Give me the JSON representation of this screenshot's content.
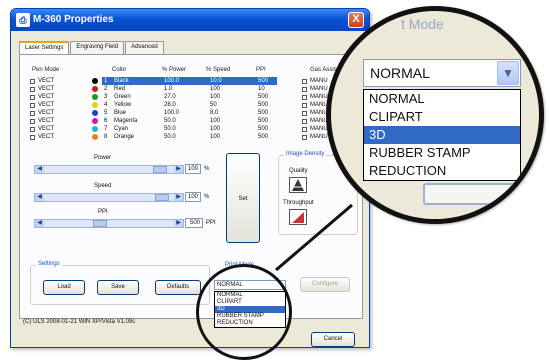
{
  "window": {
    "title": "M-360 Properties",
    "close_label": "X",
    "app_icon": "printer-icon"
  },
  "tabs": [
    {
      "label": "Laser Settings",
      "active": true
    },
    {
      "label": "Engraving Field",
      "active": false
    },
    {
      "label": "Advanced",
      "active": false
    }
  ],
  "pen_table": {
    "headers": {
      "pen_mode": "Pen Mode",
      "color": "Color",
      "power": "% Power",
      "speed": "% Speed",
      "ppi": "PPI",
      "gas_assist": "Gas Assist"
    },
    "rows": [
      {
        "mode": "VECT",
        "num": "1",
        "color": "Black",
        "swatch": "#000000",
        "power": "100.0",
        "speed": "10.0",
        "ppi": "500",
        "gas": "MANU",
        "selected": true
      },
      {
        "mode": "VECT",
        "num": "2",
        "color": "Red",
        "swatch": "#d11a1a",
        "power": "1.0",
        "speed": "100",
        "ppi": "10",
        "gas": "MANU"
      },
      {
        "mode": "VECT",
        "num": "3",
        "color": "Green",
        "swatch": "#1a9a1a",
        "power": "27.0",
        "speed": "100",
        "ppi": "500",
        "gas": "MANU"
      },
      {
        "mode": "VECT",
        "num": "4",
        "color": "Yellow",
        "swatch": "#e6d21a",
        "power": "28.0",
        "speed": "50",
        "ppi": "500",
        "gas": "MANU"
      },
      {
        "mode": "VECT",
        "num": "5",
        "color": "Blue",
        "swatch": "#1a3fd1",
        "power": "100.0",
        "speed": "8.0",
        "ppi": "500",
        "gas": "MANU"
      },
      {
        "mode": "VECT",
        "num": "6",
        "color": "Magenta",
        "swatch": "#c81ab8",
        "power": "50.0",
        "speed": "100",
        "ppi": "500",
        "gas": "MANU"
      },
      {
        "mode": "VECT",
        "num": "7",
        "color": "Cyan",
        "swatch": "#1ab8d1",
        "power": "50.0",
        "speed": "100",
        "ppi": "500",
        "gas": "MANU"
      },
      {
        "mode": "VECT",
        "num": "8",
        "color": "Orange",
        "swatch": "#e8821a",
        "power": "50.0",
        "speed": "100",
        "ppi": "500",
        "gas": "MANU"
      }
    ]
  },
  "sliders": {
    "power": {
      "label": "Power",
      "value": "100",
      "unit": "%"
    },
    "speed": {
      "label": "Speed",
      "value": "100",
      "unit": "%"
    },
    "ppi": {
      "label": "PPI",
      "value": "500",
      "unit": "PPI"
    }
  },
  "set_button": "Set",
  "image_density": {
    "title": "Image Density",
    "quality_label": "Quality",
    "throughput_label": "Throughput"
  },
  "settings": {
    "title": "Settings",
    "load": "Load",
    "save": "Save",
    "defaults": "Defaults"
  },
  "print_mode": {
    "title": "Print Mode",
    "selected": "NORMAL",
    "options": [
      "NORMAL",
      "CLIPART",
      "3D",
      "RUBBER STAMP",
      "REDUCTION"
    ],
    "highlighted": "3D",
    "configure": "Configure"
  },
  "status_text": "(C) ULS 2008-01-21 WIN XP/Vista V1.09c",
  "cancel_button": "Cancel",
  "callout": {
    "title_fragment": "t Mode",
    "selected": "NORMAL",
    "options": [
      "NORMAL",
      "CLIPART",
      "3D",
      "RUBBER STAMP",
      "REDUCTION"
    ],
    "highlighted": "3D",
    "arrow_icon": "chevron-down-icon"
  }
}
